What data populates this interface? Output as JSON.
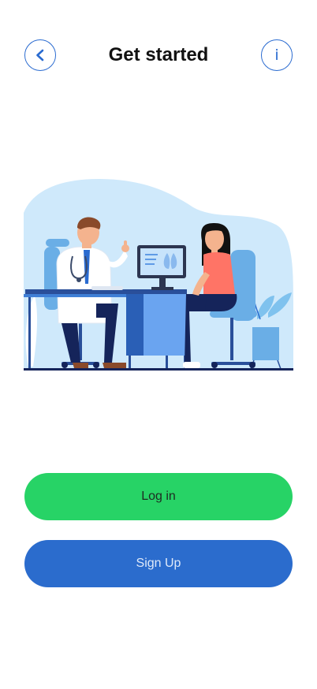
{
  "header": {
    "title": "Get started",
    "back_icon": "chevron-left-icon",
    "info_icon": "info-icon",
    "info_glyph": "i"
  },
  "illustration": {
    "icon": "doctor-patient-illustration"
  },
  "actions": {
    "login_label": "Log in",
    "signup_label": "Sign Up"
  },
  "colors": {
    "accent_blue": "#2b6ccd",
    "success_green": "#27d366",
    "background": "#ffffff"
  }
}
